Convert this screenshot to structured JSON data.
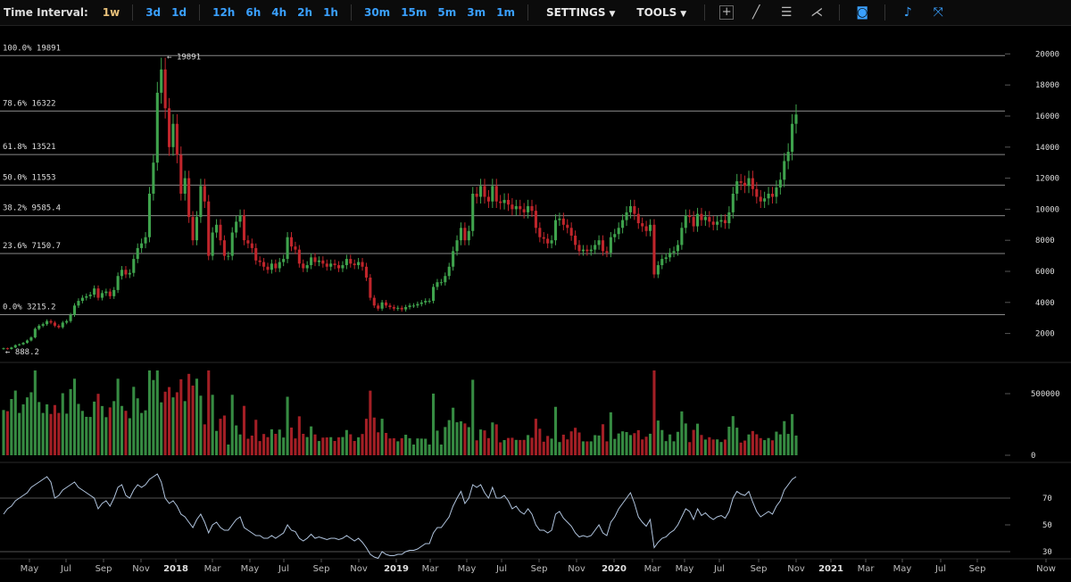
{
  "toolbar": {
    "label": "Time Interval:",
    "intervals": [
      "1w",
      "3d",
      "1d",
      "12h",
      "6h",
      "4h",
      "2h",
      "1h",
      "30m",
      "15m",
      "5m",
      "3m",
      "1m"
    ],
    "active": "1w",
    "settings": "SETTINGS",
    "tools": "TOOLS",
    "icons": [
      "crosshair-icon",
      "trendline-icon",
      "horizontal-lines-icon",
      "fan-icon",
      "camera-icon",
      "bell-icon",
      "fullscreen-icon"
    ]
  },
  "colors": {
    "up": "#3fa34d",
    "down": "#c0252b",
    "rsi": "#b0c4de",
    "grid": "#666666",
    "active_interval": "#e8c17a",
    "interval": "#3aa0ff"
  },
  "chart_data": {
    "type": "candlestick",
    "price_axis": {
      "ticks": [
        2000,
        4000,
        6000,
        8000,
        10000,
        12000,
        14000,
        16000,
        18000,
        20000
      ]
    },
    "volume_axis": {
      "ticks": [
        "500000",
        "0"
      ]
    },
    "rsi_axis": {
      "ticks": [
        "70",
        "50",
        "30"
      ]
    },
    "fib_levels": [
      {
        "label": "100.0% 19891",
        "value": 19891
      },
      {
        "label": "78.6% 16322",
        "value": 16322
      },
      {
        "label": "61.8% 13521",
        "value": 13521
      },
      {
        "label": "50.0% 11553",
        "value": 11553
      },
      {
        "label": "38.2% 9585.4",
        "value": 9585.4
      },
      {
        "label": "23.6% 7150.7",
        "value": 7150.7
      },
      {
        "label": "0.0% 3215.2",
        "value": 3215.2
      }
    ],
    "annotations": [
      {
        "text": "← 19891",
        "value": 19891,
        "index": 41
      },
      {
        "text": "← 888.2",
        "value": 888.2,
        "index": 0
      }
    ],
    "x_labels": [
      "May",
      "Jul",
      "Sep",
      "Nov",
      "2018",
      "Mar",
      "May",
      "Jul",
      "Sep",
      "Nov",
      "2019",
      "Mar",
      "May",
      "Jul",
      "Sep",
      "Nov",
      "2020",
      "Mar",
      "May",
      "Jul",
      "Sep",
      "Nov",
      "2021",
      "Mar",
      "May",
      "Jul",
      "Sep",
      "Now"
    ],
    "year_labels": [
      "2018",
      "2019",
      "2020",
      "2021"
    ],
    "close": [
      1050,
      1000,
      1100,
      1250,
      1300,
      1400,
      1550,
      1750,
      2300,
      2500,
      2600,
      2800,
      2700,
      2500,
      2400,
      2700,
      2800,
      3200,
      3800,
      4100,
      4300,
      4400,
      4500,
      4900,
      4300,
      4600,
      4700,
      4400,
      4800,
      5700,
      6100,
      5800,
      5900,
      6800,
      7500,
      7800,
      8200,
      11000,
      13000,
      17500,
      19000,
      16500,
      14000,
      15500,
      13500,
      11000,
      12000,
      9500,
      8000,
      9500,
      11500,
      10500,
      7000,
      8500,
      9000,
      8000,
      7000,
      7000,
      8500,
      9200,
      9600,
      8000,
      7800,
      7500,
      6700,
      6600,
      6300,
      6100,
      6500,
      6200,
      6600,
      6800,
      8200,
      7600,
      7400,
      6500,
      6200,
      6400,
      6900,
      6600,
      6700,
      6500,
      6300,
      6500,
      6400,
      6200,
      6400,
      6800,
      6500,
      6400,
      6600,
      6300,
      5600,
      4300,
      3800,
      3600,
      4000,
      3800,
      3700,
      3600,
      3650,
      3550,
      3700,
      3800,
      3800,
      3900,
      4000,
      4100,
      4100,
      5000,
      5300,
      5300,
      5700,
      6300,
      7300,
      8000,
      8800,
      8000,
      8600,
      11000,
      10800,
      11500,
      10800,
      10500,
      11500,
      10500,
      10400,
      10600,
      10300,
      10000,
      10200,
      10000,
      9800,
      10200,
      9900,
      8800,
      8200,
      8100,
      7800,
      8000,
      9300,
      9400,
      9000,
      8800,
      8300,
      7700,
      7300,
      7400,
      7300,
      7400,
      7700,
      8000,
      7300,
      7200,
      8200,
      8400,
      8800,
      9300,
      9800,
      10200,
      9700,
      9100,
      8900,
      8600,
      9000,
      5800,
      6400,
      6800,
      6900,
      7200,
      7300,
      7700,
      8800,
      9600,
      9500,
      8900,
      9700,
      9300,
      9500,
      9200,
      9000,
      9200,
      9300,
      9100,
      9800,
      11000,
      11800,
      11700,
      11500,
      12000,
      11300,
      10800,
      10500,
      10700,
      11000,
      10800,
      11400,
      11900,
      13100,
      13700,
      15500,
      16100
    ],
    "rsi": [
      58,
      62,
      64,
      68,
      70,
      72,
      74,
      78,
      80,
      82,
      84,
      86,
      82,
      70,
      72,
      76,
      78,
      80,
      82,
      78,
      76,
      74,
      72,
      70,
      62,
      66,
      68,
      64,
      70,
      78,
      80,
      72,
      70,
      76,
      80,
      78,
      80,
      84,
      86,
      88,
      82,
      70,
      66,
      68,
      64,
      58,
      56,
      52,
      48,
      54,
      58,
      52,
      44,
      50,
      52,
      48,
      46,
      46,
      50,
      54,
      56,
      48,
      46,
      44,
      42,
      42,
      40,
      40,
      42,
      40,
      42,
      44,
      50,
      46,
      45,
      40,
      38,
      40,
      43,
      40,
      41,
      40,
      39,
      40,
      40,
      39,
      40,
      42,
      40,
      38,
      40,
      37,
      33,
      28,
      26,
      25,
      30,
      28,
      27,
      27,
      28,
      28,
      30,
      31,
      31,
      32,
      34,
      36,
      36,
      44,
      48,
      48,
      52,
      56,
      64,
      70,
      75,
      66,
      70,
      80,
      78,
      80,
      74,
      70,
      78,
      70,
      70,
      72,
      68,
      62,
      64,
      60,
      58,
      62,
      58,
      50,
      46,
      46,
      44,
      46,
      58,
      60,
      55,
      52,
      49,
      44,
      41,
      42,
      41,
      42,
      46,
      50,
      44,
      42,
      52,
      56,
      62,
      66,
      70,
      74,
      66,
      56,
      52,
      49,
      54,
      33,
      37,
      40,
      41,
      44,
      46,
      50,
      56,
      62,
      60,
      54,
      62,
      57,
      59,
      56,
      54,
      56,
      57,
      55,
      60,
      70,
      75,
      73,
      72,
      75,
      67,
      60,
      56,
      58,
      60,
      58,
      64,
      68,
      76,
      80,
      84,
      86
    ]
  }
}
